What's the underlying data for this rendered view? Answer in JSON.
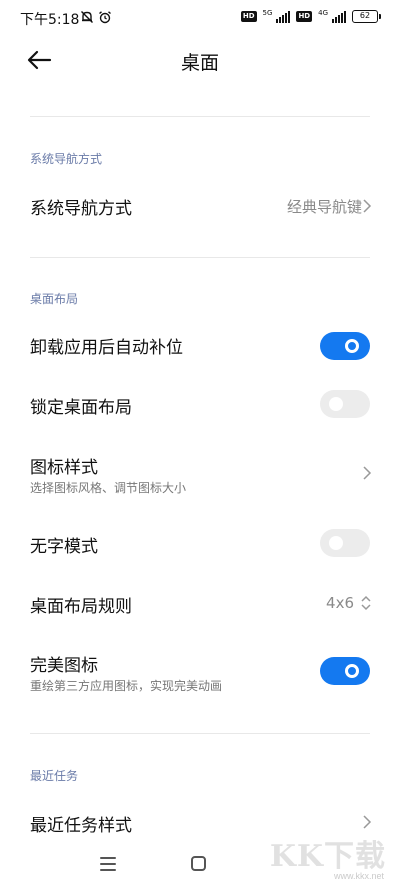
{
  "status_bar": {
    "time": "下午5:18",
    "network_1": "5G",
    "network_2": "4G",
    "hd_label": "HD",
    "battery": "62"
  },
  "header": {
    "title": "桌面"
  },
  "sections": {
    "navigation": {
      "title": "系统导航方式",
      "nav_mode": {
        "label": "系统导航方式",
        "value": "经典导航键"
      }
    },
    "layout": {
      "title": "桌面布局",
      "auto_fill": {
        "label": "卸载应用后自动补位",
        "enabled": true
      },
      "lock_layout": {
        "label": "锁定桌面布局",
        "enabled": false
      },
      "icon_style": {
        "label": "图标样式",
        "subtitle": "选择图标风格、调节图标大小"
      },
      "no_text_mode": {
        "label": "无字模式",
        "enabled": false
      },
      "grid_rule": {
        "label": "桌面布局规则",
        "value": "4x6"
      },
      "perfect_icons": {
        "label": "完美图标",
        "subtitle": "重绘第三方应用图标，实现完美动画",
        "enabled": true
      }
    },
    "recents": {
      "title": "最近任务",
      "recents_style": {
        "label": "最近任务样式"
      }
    }
  },
  "watermark": {
    "text": "KK下载",
    "url": "www.kkx.net"
  },
  "colors": {
    "accent": "#1479f0",
    "section_title": "#6a7ba8",
    "toggle_off": "#ececec"
  }
}
